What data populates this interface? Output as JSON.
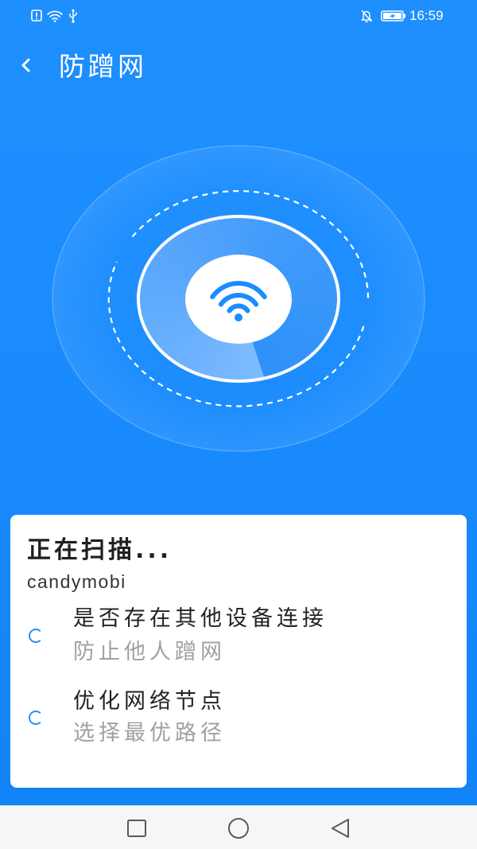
{
  "status_bar": {
    "time": "16:59",
    "left_icons": [
      "alert-icon",
      "wifi-signal-icon",
      "usb-icon"
    ],
    "right_icons": [
      "notifications-off-icon",
      "battery-charging-icon"
    ]
  },
  "header": {
    "back_icon": "chevron-left-icon",
    "title": "防蹭网"
  },
  "scanner": {
    "center_icon": "wifi-icon"
  },
  "card": {
    "title": "正在扫描...",
    "network_name": "candymobi",
    "items": [
      {
        "title": "是否存在其他设备连接",
        "subtitle": "防止他人蹭网",
        "status_icon": "loading-spinner-icon"
      },
      {
        "title": "优化网络节点",
        "subtitle": "选择最优路径",
        "status_icon": "loading-spinner-icon"
      }
    ]
  },
  "nav_bar": {
    "buttons": [
      "recent-apps-icon",
      "home-icon",
      "back-icon"
    ]
  },
  "colors": {
    "background": "#1A8CFE",
    "accent": "#1A8CFF",
    "card": "#FFFFFF",
    "title_text": "#222222",
    "subtitle_text": "#A0A0A0",
    "nav_bar": "#F6F6F6"
  }
}
